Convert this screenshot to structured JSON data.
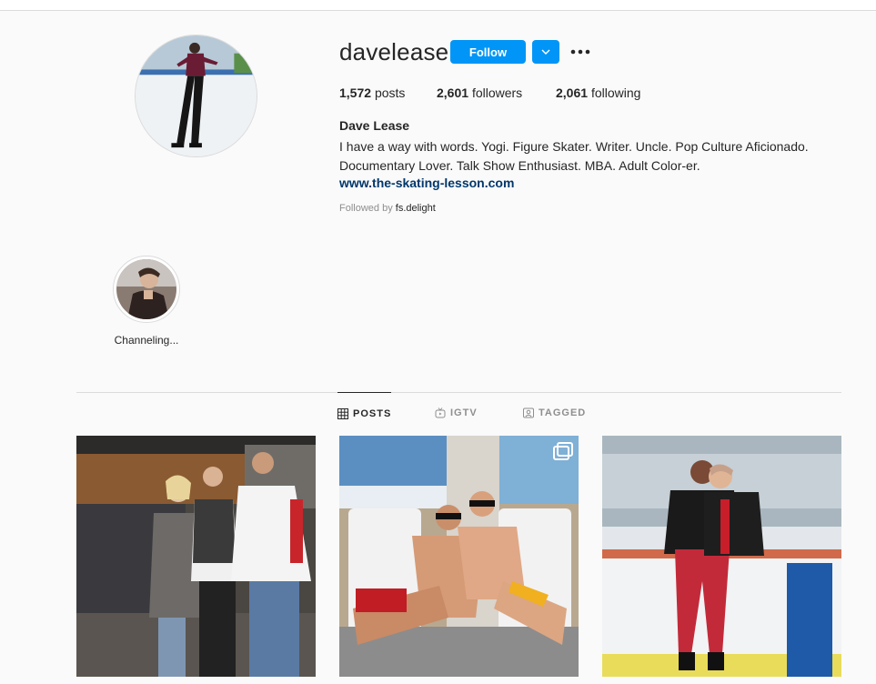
{
  "profile": {
    "username": "davelease",
    "follow_label": "Follow",
    "more_label": "•••",
    "stats": {
      "posts_count": "1,572",
      "posts_label": "posts",
      "followers_count": "2,601",
      "followers_label": "followers",
      "following_count": "2,061",
      "following_label": "following"
    },
    "full_name": "Dave Lease",
    "bio_line1": "I have a way with words. Yogi. Figure Skater. Writer. Uncle. Pop Culture Aficionado.",
    "bio_line2": "Documentary Lover. Talk Show Enthusiast. MBA. Adult Color-er.",
    "website": "www.the-skating-lesson.com",
    "followed_by_prefix": "Followed by",
    "followed_by_name": "fs.delight"
  },
  "highlights": [
    {
      "label": "Channeling..."
    }
  ],
  "tabs": [
    {
      "label": "POSTS",
      "icon": "grid-icon",
      "active": true
    },
    {
      "label": "IGTV",
      "icon": "igtv-icon",
      "active": false
    },
    {
      "label": "TAGGED",
      "icon": "tagged-icon",
      "active": false
    }
  ],
  "posts": [
    {
      "icon": "photo-group-rink-icon"
    },
    {
      "icon": "photo-poolside-icon",
      "multi": true
    },
    {
      "icon": "photo-ice-rink-icon"
    }
  ],
  "colors": {
    "accent": "#0095f6",
    "link": "#00376b",
    "muted": "#8e8e8e",
    "text": "#262626",
    "background": "#fafafa"
  }
}
